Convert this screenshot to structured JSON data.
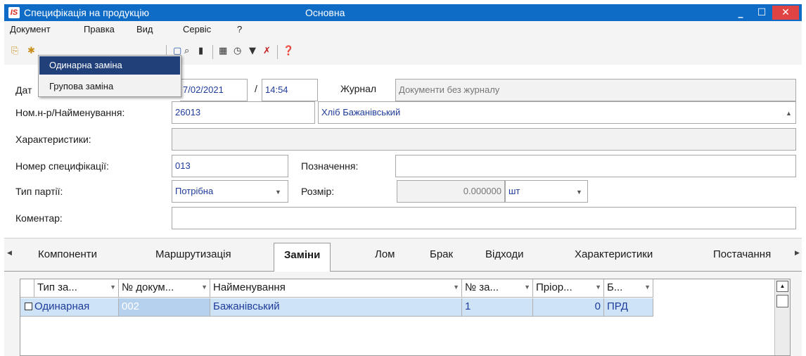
{
  "window": {
    "title": "Специфікація на продукцію",
    "subtitle": "Основна",
    "minimize": "_",
    "maximize": "☐",
    "close": "✕",
    "logo": "IS"
  },
  "menu": [
    "Документ",
    "Правка",
    "Вид",
    "Сервіс",
    "?"
  ],
  "dropdown": {
    "items": [
      "Одинарна заміна",
      "Групова заміна"
    ]
  },
  "form": {
    "date_label": "Дат",
    "date_value": "7/02/2021",
    "time_sep": "/",
    "time_value": "14:54",
    "journal_label": "Журнал",
    "journal_value": "Документи без журналу",
    "item_label": "Ном.н-р/Найменування:",
    "item_code": "26013",
    "item_name": "Хліб Бажанівський",
    "chars_label": "Характеристики:",
    "chars_value": "",
    "spec_label": "Номер специфікації:",
    "spec_value": "013",
    "designation_label": "Позначення:",
    "designation_value": "",
    "batch_label": "Тип партії:",
    "batch_value": "Потрібна",
    "size_label": "Розмір:",
    "size_value": "0.000000",
    "unit_value": "шт",
    "comment_label": "Коментар:",
    "comment_value": ""
  },
  "tabs": [
    "Компоненти",
    "Маршрутизація",
    "Заміни",
    "Лом",
    "Брак",
    "Відходи",
    "Характеристики",
    "Постачання"
  ],
  "active_tab": "Заміни",
  "grid": {
    "headers": [
      "Тип за...",
      "№ докум...",
      "Найменування",
      "№ за...",
      "Пріор...",
      "Б..."
    ],
    "rows": [
      [
        "Одинарная",
        "002",
        "Бажанівський",
        "1",
        "0",
        "ПРД"
      ]
    ]
  },
  "colors": {
    "titlebar": "#0f6cc6",
    "close_button": "#e04343",
    "menu_selected": "#21407a",
    "row_highlight": "#cfe3f7"
  }
}
